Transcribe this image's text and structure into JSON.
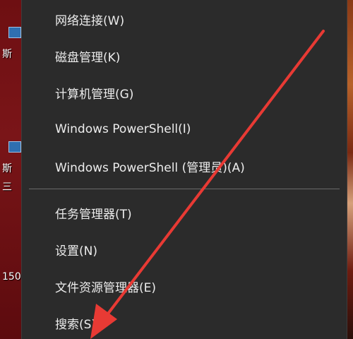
{
  "desktop": {
    "left_labels": [
      "斯",
      "斯",
      "三",
      "150"
    ]
  },
  "context_menu": {
    "group1": [
      {
        "label": "网络连接(W)"
      },
      {
        "label": "磁盘管理(K)"
      },
      {
        "label": "计算机管理(G)"
      },
      {
        "label": "Windows PowerShell(I)"
      },
      {
        "label": "Windows PowerShell (管理员)(A)"
      }
    ],
    "group2": [
      {
        "label": "任务管理器(T)"
      },
      {
        "label": "设置(N)"
      },
      {
        "label": "文件资源管理器(E)"
      },
      {
        "label": "搜索(S)"
      }
    ]
  },
  "colors": {
    "menu_bg": "#2b2b2b",
    "menu_text": "#ececec",
    "separator": "#6a6a6a",
    "annotation_arrow": "#e83a34"
  }
}
